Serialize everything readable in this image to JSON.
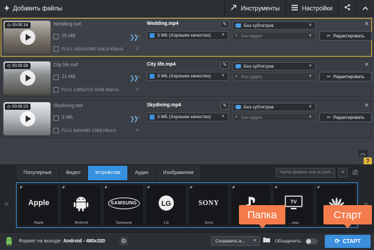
{
  "toolbar": {
    "add_files": "Добавить файлы",
    "tools": "Инструменты",
    "settings": "Настройки"
  },
  "files": [
    {
      "timecode": "00:00:16",
      "name": "Wedding.swf",
      "size": "25 МБ",
      "info": "FLV1 1920x1080 11613 Кбит/с",
      "output_name": "Wedding.mp4",
      "quality": "3 МБ (Хорошее качество)",
      "subtitles": "Без субтитров",
      "audio": "Без аудио",
      "edit": "Редактировать",
      "selected": true
    },
    {
      "timecode": "00:00:28",
      "name": "City life.swf",
      "size": "21 МБ",
      "info": "FLV1 1280x720 5938 Кбит/с",
      "output_name": "City life.mp4",
      "quality": "3 МБ (Хорошее качество)",
      "subtitles": "Без субтитров",
      "audio": "Без аудио",
      "edit": "Редактировать",
      "selected": false
    },
    {
      "timecode": "00:00:23",
      "name": "Skydiving.swf",
      "size": "3 МБ",
      "info": "FLV1 640x480 1988 Кбит/с",
      "output_name": "Skydiving.mp4",
      "quality": "3 МБ (Хорошее качество)",
      "subtitles": "Без субтитров",
      "audio": "Без аудио",
      "edit": "Редактировать",
      "selected": false
    }
  ],
  "format_tabs": [
    "Популярные",
    "Видео",
    "Устройства",
    "Аудио",
    "Изображения"
  ],
  "active_tab": "Устройства",
  "format_search_placeholder": "Найти формат или устрой...",
  "devices": [
    {
      "logo": "Apple",
      "label": "Apple"
    },
    {
      "logo": "android-icon",
      "label": "Android"
    },
    {
      "logo": "SAMSUNG",
      "label": "Samsung"
    },
    {
      "logo": "lg-icon",
      "label": "LG"
    },
    {
      "logo": "SONY",
      "label": "Sony"
    },
    {
      "logo": "playstation-icon",
      "label": ""
    },
    {
      "logo": "tv-icon",
      "label": "...оры"
    },
    {
      "logo": "huawei-icon",
      "label": ""
    }
  ],
  "bottom": {
    "output_format_label": "Формат на выходе:",
    "output_format_value": "Android",
    "output_format_res": "- 480x320",
    "save_to": "Сохранить в...",
    "merge": "Объединить:",
    "start": "СТАРТ"
  },
  "callouts": {
    "folder": "Папка",
    "start": "Старт"
  },
  "colors": {
    "accent": "#3b8fdc",
    "selection": "#e2b53c",
    "callout": "#f47c4c"
  }
}
